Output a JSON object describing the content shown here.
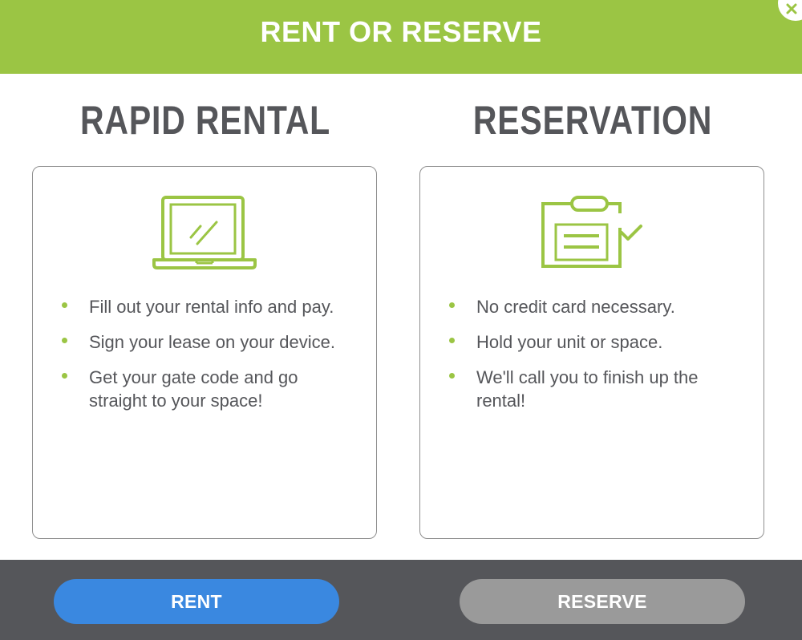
{
  "header": {
    "title": "RENT OR RESERVE"
  },
  "colors": {
    "brand_green": "#9bc544",
    "text_gray": "#55565a",
    "rent_blue": "#3a88e0",
    "reserve_gray": "#9a9a9a"
  },
  "rapid_rental": {
    "title": "RAPID RENTAL",
    "icon": "laptop-icon",
    "bullets": [
      "Fill out your rental info and pay.",
      "Sign your lease on your device.",
      "Get your gate code and go straight to your space!"
    ]
  },
  "reservation": {
    "title": "RESERVATION",
    "icon": "clipboard-check-icon",
    "bullets": [
      "No credit card necessary.",
      "Hold your unit or space.",
      "We'll call you to finish up the rental!"
    ]
  },
  "footer": {
    "rent_label": "RENT",
    "reserve_label": "RESERVE"
  }
}
